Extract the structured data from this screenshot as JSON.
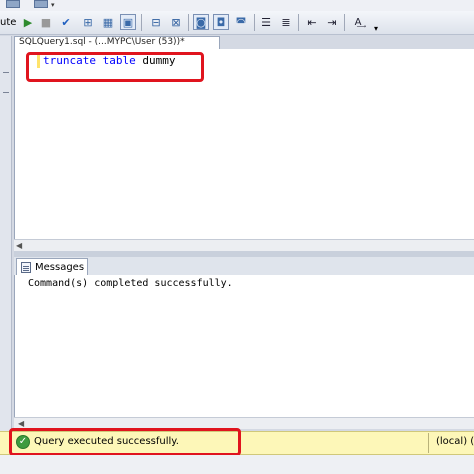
{
  "toolbar": {
    "execute_label": "ute",
    "icons": [
      "execute-icon",
      "debug-icon",
      "stop-icon",
      "parse-icon",
      "display-plan-icon",
      "query-designer-icon",
      "options-icon",
      "results-to-grid-icon",
      "results-to-text-icon",
      "comment-icon",
      "uncomment-icon",
      "indent-icon",
      "outdent-icon",
      "specify-values-icon"
    ]
  },
  "document_tab": {
    "title": "SQLQuery1.sql - (...MYPC\\User (53))*"
  },
  "editor": {
    "code_keywords": [
      "truncate",
      "table"
    ],
    "code_identifier": "dummy"
  },
  "results": {
    "tab_label": "Messages",
    "message": "Command(s) completed successfully."
  },
  "status": {
    "text": "Query executed successfully.",
    "server": "(local) (1"
  },
  "colors": {
    "keyword": "#0000ff",
    "highlight_box": "#e0141e",
    "status_bar": "#fdf7b8",
    "success_icon": "#3f9b3f"
  }
}
